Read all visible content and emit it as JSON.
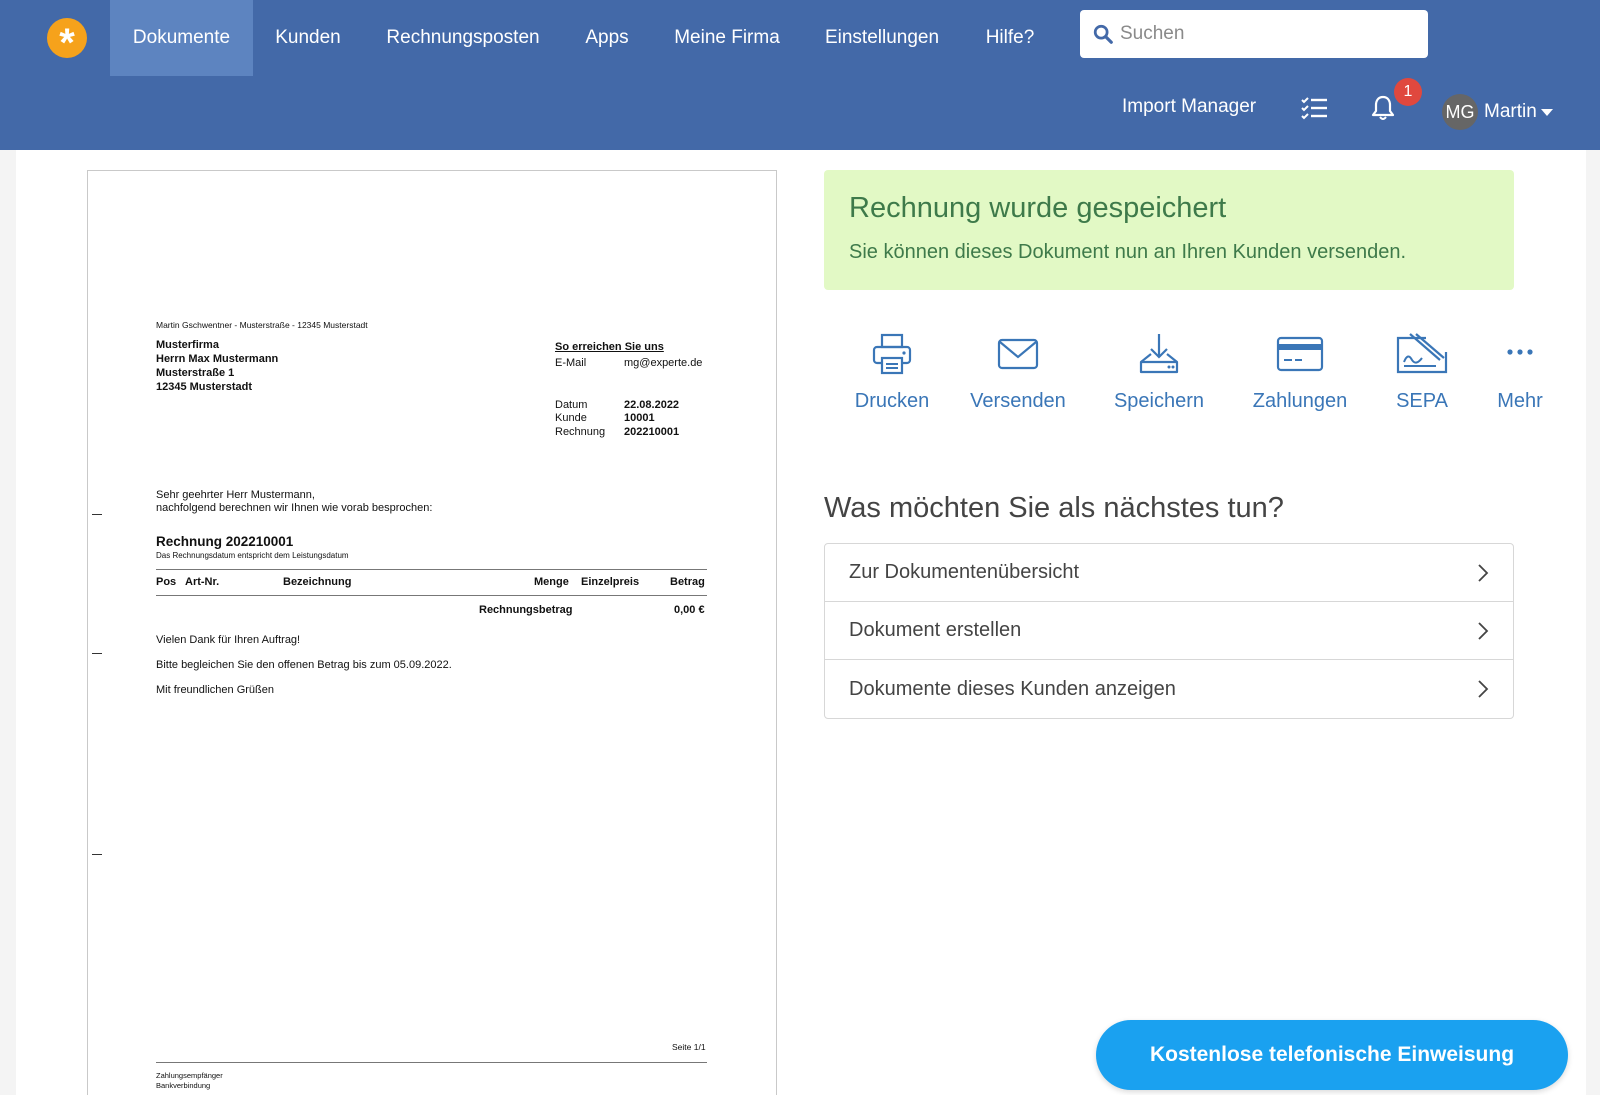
{
  "navbar": {
    "items": [
      {
        "label": "Dokumente",
        "active": true
      },
      {
        "label": "Kunden"
      },
      {
        "label": "Rechnungsposten"
      },
      {
        "label": "Apps"
      },
      {
        "label": "Meine Firma"
      },
      {
        "label": "Einstellungen"
      },
      {
        "label": "Hilfe?"
      }
    ],
    "search_placeholder": "Suchen",
    "import_manager": "Import Manager",
    "notifications_count": "1",
    "user_initials": "MG",
    "user_name": "Martin"
  },
  "document": {
    "sender_line": "Martin Gschwentner - Musterstraße - 12345 Musterstadt",
    "recipient": [
      "Musterfirma",
      "Herrn Max Mustermann",
      "Musterstraße 1",
      "12345 Musterstadt"
    ],
    "contact_heading": "So erreichen Sie uns",
    "email_label": "E-Mail",
    "email_value": "mg@experte.de",
    "date_label": "Datum",
    "date_value": "22.08.2022",
    "customer_label": "Kunde",
    "customer_value": "10001",
    "invoice_label": "Rechnung",
    "invoice_value": "202210001",
    "salutation": "Sehr geehrter Herr Mustermann,",
    "intro": "nachfolgend berechnen wir Ihnen wie vorab besprochen:",
    "title": "Rechnung 202210001",
    "subtitle": "Das Rechnungsdatum entspricht dem Leistungsdatum",
    "columns": {
      "pos": "Pos",
      "art": "Art-Nr.",
      "desc": "Bezeichnung",
      "qty": "Menge",
      "unit": "Einzelpreis",
      "amount": "Betrag"
    },
    "total_label": "Rechnungsbetrag",
    "total_value": "0,00 €",
    "thanks": "Vielen Dank für Ihren Auftrag!",
    "payment_note": "Bitte begleichen Sie den offenen Betrag bis zum 05.09.2022.",
    "closing": "Mit freundlichen Grüßen",
    "page": "Seite 1/1",
    "footer_1": "Zahlungsempfänger",
    "footer_2": "Bankverbindung"
  },
  "alert": {
    "title": "Rechnung wurde gespeichert",
    "text": "Sie können dieses Dokument nun an Ihren Kunden versenden."
  },
  "actions": [
    {
      "label": "Drucken",
      "icon": "printer-icon"
    },
    {
      "label": "Versenden",
      "icon": "envelope-icon"
    },
    {
      "label": "Speichern",
      "icon": "download-icon"
    },
    {
      "label": "Zahlungen",
      "icon": "credit-card-icon"
    },
    {
      "label": "SEPA",
      "icon": "sepa-sign-icon"
    },
    {
      "label": "Mehr",
      "icon": "more-dots-icon"
    }
  ],
  "next_steps": {
    "title": "Was möchten Sie als nächstes tun?",
    "items": [
      "Zur Dokumentenübersicht",
      "Dokument erstellen",
      "Dokumente dieses Kunden anzeigen"
    ]
  },
  "cta": "Kostenlose telefonische Einweisung",
  "colors": {
    "navbar": "#4369a8",
    "nav_active": "#5d84c0",
    "logo": "#f6a21b",
    "alert_bg": "#e2f9c5",
    "alert_text": "#3e7a4a",
    "action": "#3a76b7",
    "cta": "#1aa1f0",
    "badge": "#e0483e"
  }
}
